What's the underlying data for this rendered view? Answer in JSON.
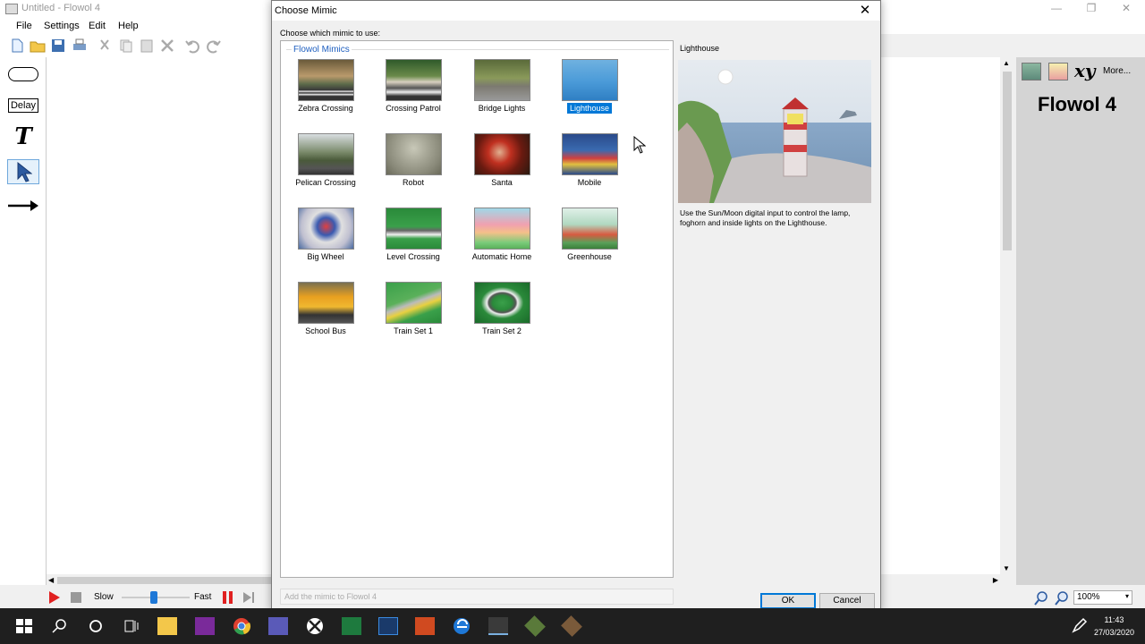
{
  "app": {
    "title": "Untitled - Flowol 4",
    "menu": [
      "File",
      "Settings",
      "Edit",
      "Help"
    ],
    "brand": "Flowol 4",
    "more_label": "More...",
    "xy_label": "xy",
    "left_tools": {
      "delay_label": "Delay",
      "text_label": "T"
    },
    "speed": {
      "slow": "Slow",
      "fast": "Fast"
    },
    "zoom": "100%"
  },
  "dialog": {
    "title": "Choose Mimic",
    "prompt": "Choose which mimic to use:",
    "group_label": "Flowol Mimics",
    "mimics": [
      {
        "name": "Zebra Crossing",
        "selected": false
      },
      {
        "name": "Crossing Patrol",
        "selected": false
      },
      {
        "name": "Bridge Lights",
        "selected": false
      },
      {
        "name": "Lighthouse",
        "selected": true
      },
      {
        "name": "Pelican Crossing",
        "selected": false
      },
      {
        "name": "Robot",
        "selected": false
      },
      {
        "name": "Santa",
        "selected": false
      },
      {
        "name": "Mobile",
        "selected": false
      },
      {
        "name": "Big Wheel",
        "selected": false
      },
      {
        "name": "Level Crossing",
        "selected": false
      },
      {
        "name": "Automatic Home",
        "selected": false
      },
      {
        "name": "Greenhouse",
        "selected": false
      },
      {
        "name": "School Bus",
        "selected": false
      },
      {
        "name": "Train Set 1",
        "selected": false
      },
      {
        "name": "Train Set 2",
        "selected": false
      }
    ],
    "preview": {
      "title": "Lighthouse",
      "description": "Use the Sun/Moon digital input to control the lamp, foghorn and inside lights on the Lighthouse."
    },
    "add_mimic_label": "Add the mimic to Flowol 4",
    "ok_label": "OK",
    "cancel_label": "Cancel"
  },
  "taskbar": {
    "time": "11:43",
    "date": "27/03/2020"
  }
}
